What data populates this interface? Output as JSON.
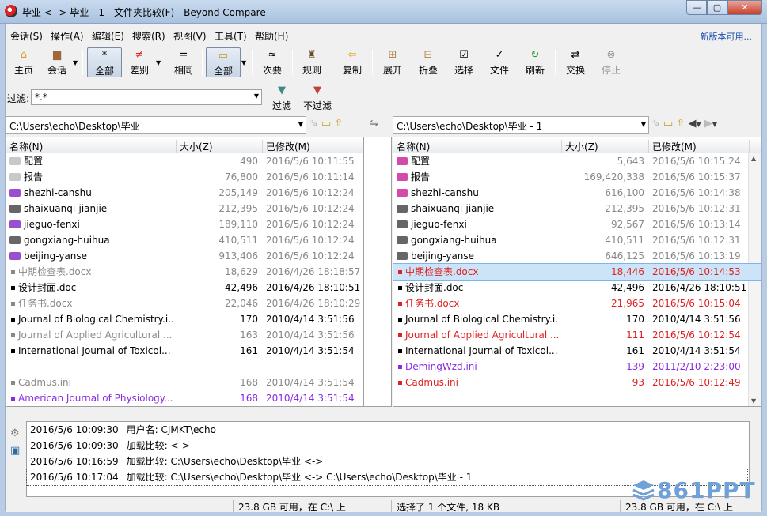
{
  "window": {
    "title": "毕业 <--> 毕业 - 1 - 文件夹比较(F) - Beyond Compare",
    "minimize": "—",
    "maximize": "▢",
    "close": "✕"
  },
  "menu": {
    "items": [
      "会话(S)",
      "操作(A)",
      "编辑(E)",
      "搜索(R)",
      "视图(V)",
      "工具(T)",
      "帮助(H)"
    ],
    "update": "新版本可用..."
  },
  "toolbar": {
    "home": "主页",
    "session": "会话",
    "all": "全部",
    "diff": "差别",
    "same": "相同",
    "all2": "全部",
    "minor": "次要",
    "rules": "规则",
    "copy": "复制",
    "expand": "展开",
    "collapse": "折叠",
    "select": "选择",
    "files": "文件",
    "refresh": "刷新",
    "swap": "交换",
    "stop": "停止"
  },
  "filter": {
    "label": "过滤:",
    "value": "*.*",
    "apply": "过滤",
    "clear": "不过滤"
  },
  "left": {
    "path": "C:\\Users\\echo\\Desktop\\毕业",
    "headers": {
      "name": "名称(N)",
      "size": "大小(Z)",
      "modified": "已修改(M)"
    },
    "rows": [
      {
        "name": "配置",
        "size": "490",
        "date": "2016/5/6 10:11:55",
        "kind": "folder",
        "color": "#c8c8c8",
        "text": "#000",
        "meta": "#888"
      },
      {
        "name": "报告",
        "size": "76,800",
        "date": "2016/5/6 10:11:14",
        "kind": "folder",
        "color": "#c8c8c8",
        "text": "#000",
        "meta": "#888"
      },
      {
        "name": "shezhi-canshu",
        "size": "205,149",
        "date": "2016/5/6 10:12:24",
        "kind": "folder",
        "color": "#9b4fd0",
        "text": "#000",
        "meta": "#888"
      },
      {
        "name": "shaixuanqi-jianjie",
        "size": "212,395",
        "date": "2016/5/6 10:12:24",
        "kind": "folder",
        "color": "#666",
        "text": "#000",
        "meta": "#888"
      },
      {
        "name": "jieguo-fenxi",
        "size": "189,110",
        "date": "2016/5/6 10:12:24",
        "kind": "folder",
        "color": "#9b4fd0",
        "text": "#000",
        "meta": "#888"
      },
      {
        "name": "gongxiang-huihua",
        "size": "410,511",
        "date": "2016/5/6 10:12:24",
        "kind": "folder",
        "color": "#666",
        "text": "#000",
        "meta": "#888"
      },
      {
        "name": "beijing-yanse",
        "size": "913,406",
        "date": "2016/5/6 10:12:24",
        "kind": "folder",
        "color": "#9b4fd0",
        "text": "#000",
        "meta": "#888"
      },
      {
        "name": "中期检查表.docx",
        "size": "18,629",
        "date": "2016/4/26 18:18:57",
        "kind": "file",
        "color": "#888",
        "text": "#888",
        "meta": "#888"
      },
      {
        "name": "设计封面.doc",
        "size": "42,496",
        "date": "2016/4/26 18:10:51",
        "kind": "file",
        "color": "#000",
        "text": "#000",
        "meta": "#000"
      },
      {
        "name": "任务书.docx",
        "size": "22,046",
        "date": "2016/4/26 18:10:29",
        "kind": "file",
        "color": "#888",
        "text": "#888",
        "meta": "#888"
      },
      {
        "name": "Journal of Biological Chemistry.i...",
        "size": "170",
        "date": "2010/4/14 3:51:56",
        "kind": "file",
        "color": "#000",
        "text": "#000",
        "meta": "#000"
      },
      {
        "name": "Journal of Applied Agricultural ...",
        "size": "163",
        "date": "2010/4/14 3:51:56",
        "kind": "file",
        "color": "#888",
        "text": "#888",
        "meta": "#888"
      },
      {
        "name": "International Journal of Toxicol...",
        "size": "161",
        "date": "2010/4/14 3:51:54",
        "kind": "file",
        "color": "#000",
        "text": "#000",
        "meta": "#000"
      },
      {
        "name": "",
        "size": "",
        "date": "",
        "kind": "empty",
        "color": "#fff",
        "text": "#000",
        "meta": "#000"
      },
      {
        "name": "Cadmus.ini",
        "size": "168",
        "date": "2010/4/14 3:51:54",
        "kind": "file",
        "color": "#888",
        "text": "#888",
        "meta": "#888"
      },
      {
        "name": "American Journal of Physiology....",
        "size": "168",
        "date": "2010/4/14 3:51:54",
        "kind": "file",
        "color": "#8a2be2",
        "text": "#8a2be2",
        "meta": "#8a2be2"
      }
    ]
  },
  "right": {
    "path": "C:\\Users\\echo\\Desktop\\毕业 - 1",
    "headers": {
      "name": "名称(N)",
      "size": "大小(Z)",
      "modified": "已修改(M)"
    },
    "rows": [
      {
        "name": "配置",
        "size": "5,643",
        "date": "2016/5/6 10:15:24",
        "kind": "folder",
        "color": "#d34aa8",
        "text": "#000",
        "meta": "#888"
      },
      {
        "name": "报告",
        "size": "169,420,338",
        "date": "2016/5/6 10:15:37",
        "kind": "folder",
        "color": "#d34aa8",
        "text": "#000",
        "meta": "#888"
      },
      {
        "name": "shezhi-canshu",
        "size": "616,100",
        "date": "2016/5/6 10:14:38",
        "kind": "folder",
        "color": "#d34aa8",
        "text": "#000",
        "meta": "#888"
      },
      {
        "name": "shaixuanqi-jianjie",
        "size": "212,395",
        "date": "2016/5/6 10:12:31",
        "kind": "folder",
        "color": "#666",
        "text": "#000",
        "meta": "#888"
      },
      {
        "name": "jieguo-fenxi",
        "size": "92,567",
        "date": "2016/5/6 10:13:14",
        "kind": "folder",
        "color": "#666",
        "text": "#000",
        "meta": "#888"
      },
      {
        "name": "gongxiang-huihua",
        "size": "410,511",
        "date": "2016/5/6 10:12:31",
        "kind": "folder",
        "color": "#666",
        "text": "#000",
        "meta": "#888"
      },
      {
        "name": "beijing-yanse",
        "size": "646,125",
        "date": "2016/5/6 10:13:19",
        "kind": "folder",
        "color": "#666",
        "text": "#000",
        "meta": "#888"
      },
      {
        "name": "中期检查表.docx",
        "size": "18,446",
        "date": "2016/5/6 10:14:53",
        "kind": "file",
        "color": "#e02020",
        "text": "#e02020",
        "meta": "#e02020",
        "selected": "true"
      },
      {
        "name": "设计封面.doc",
        "size": "42,496",
        "date": "2016/4/26 18:10:51",
        "kind": "file",
        "color": "#000",
        "text": "#000",
        "meta": "#000"
      },
      {
        "name": "任务书.docx",
        "size": "21,965",
        "date": "2016/5/6 10:15:04",
        "kind": "file",
        "color": "#e02020",
        "text": "#e02020",
        "meta": "#e02020"
      },
      {
        "name": "Journal of Biological Chemistry.i...",
        "size": "170",
        "date": "2010/4/14 3:51:56",
        "kind": "file",
        "color": "#000",
        "text": "#000",
        "meta": "#000"
      },
      {
        "name": "Journal of Applied Agricultural ...",
        "size": "111",
        "date": "2016/5/6 10:12:54",
        "kind": "file",
        "color": "#e02020",
        "text": "#e02020",
        "meta": "#e02020"
      },
      {
        "name": "International Journal of Toxicol...",
        "size": "161",
        "date": "2010/4/14 3:51:54",
        "kind": "file",
        "color": "#000",
        "text": "#000",
        "meta": "#000"
      },
      {
        "name": "DemingWzd.ini",
        "size": "139",
        "date": "2011/2/10 2:23:00",
        "kind": "file",
        "color": "#8a2be2",
        "text": "#8a2be2",
        "meta": "#8a2be2"
      },
      {
        "name": "Cadmus.ini",
        "size": "93",
        "date": "2016/5/6 10:12:49",
        "kind": "file",
        "color": "#e02020",
        "text": "#e02020",
        "meta": "#e02020"
      }
    ]
  },
  "log": [
    {
      "time": "2016/5/6 10:09:30",
      "msg": "用户名: CJMKT\\echo"
    },
    {
      "time": "2016/5/6 10:09:30",
      "msg": "加载比较: <->"
    },
    {
      "time": "2016/5/6 10:16:59",
      "msg": "加载比较: C:\\Users\\echo\\Desktop\\毕业 <->"
    },
    {
      "time": "2016/5/6 10:17:04",
      "msg": "加载比较: C:\\Users\\echo\\Desktop\\毕业 <-> C:\\Users\\echo\\Desktop\\毕业 - 1"
    }
  ],
  "status": {
    "left": "23.8 GB 可用，在 C:\\ 上",
    "middle": "选择了 1 个文件, 18 KB",
    "right": "23.8 GB 可用，在 C:\\ 上"
  },
  "watermark": "861PPT"
}
